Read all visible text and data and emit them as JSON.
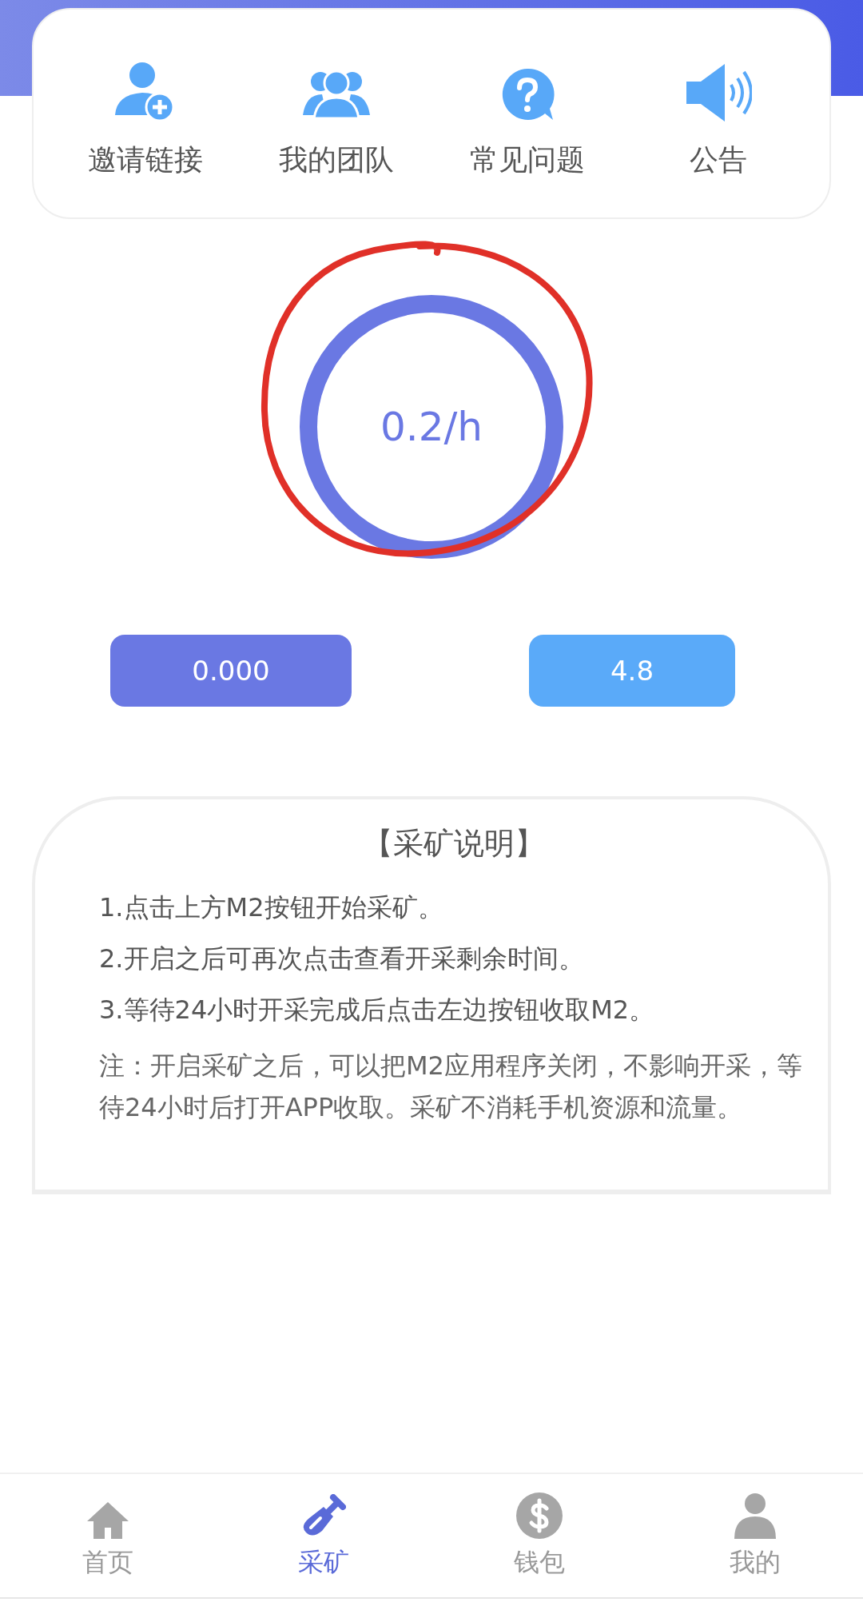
{
  "shortcuts": [
    {
      "kind": "invite",
      "label": "邀请链接"
    },
    {
      "kind": "team",
      "label": "我的团队"
    },
    {
      "kind": "faq",
      "label": "常见问题"
    },
    {
      "kind": "notice",
      "label": "公告"
    }
  ],
  "mining": {
    "rate": "0.2/h",
    "annotated": true
  },
  "buttons": [
    {
      "kind": "primary",
      "label": "0.000"
    },
    {
      "kind": "secondary",
      "label": "4.8"
    }
  ],
  "instructions": {
    "title": "【采矿说明】",
    "steps": [
      "1.点击上方M2按钮开始采矿。",
      "2.开启之后可再次点击查看开采剩余时间。",
      "3.等待24小时开采完成后点击左边按钮收取M2。"
    ],
    "note": "注：开启采矿之后，可以把M2应用程序关闭，不影响开采，等待24小时后打开APP收取。采矿不消耗手机资源和流量。"
  },
  "tabbar": [
    {
      "kind": "home",
      "label": "首页",
      "selected": false
    },
    {
      "kind": "mine",
      "label": "采矿",
      "selected": true
    },
    {
      "kind": "wallet",
      "label": "钱包",
      "selected": false
    },
    {
      "kind": "profile",
      "label": "我的",
      "selected": false
    }
  ]
}
